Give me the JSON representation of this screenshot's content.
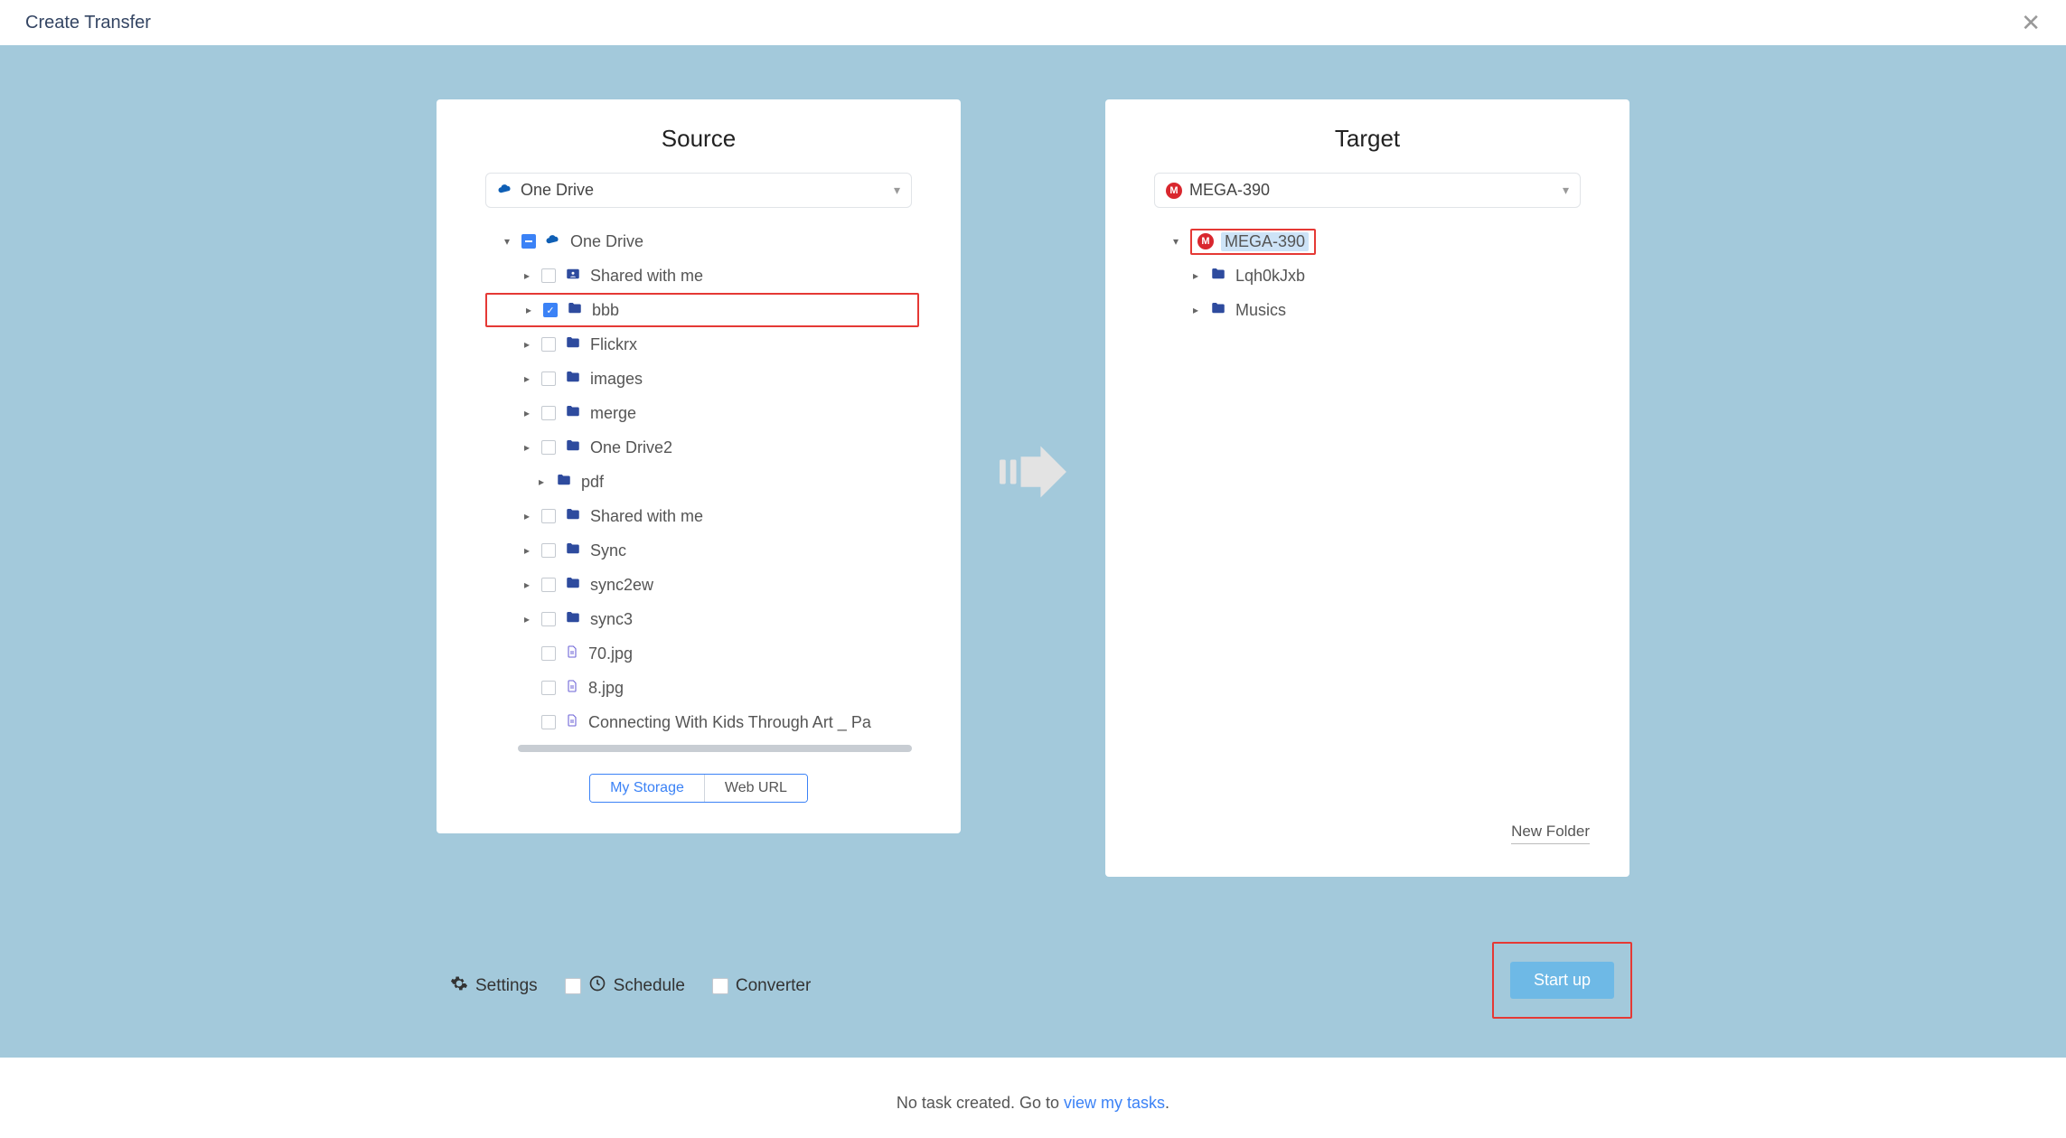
{
  "header": {
    "title": "Create Transfer",
    "close_glyph": "✕"
  },
  "source": {
    "title": "Source",
    "selected_service": "One Drive",
    "root": {
      "label": "One Drive"
    },
    "children": [
      {
        "type": "shared",
        "label": "Shared with me"
      },
      {
        "type": "folder",
        "label": "bbb",
        "checked": true,
        "highlight": true
      },
      {
        "type": "folder",
        "label": "Flickrx"
      },
      {
        "type": "folder",
        "label": "images"
      },
      {
        "type": "folder",
        "label": "merge"
      },
      {
        "type": "folder",
        "label": "One Drive2"
      },
      {
        "type": "folder",
        "label": "pdf",
        "depth2": true
      },
      {
        "type": "folder",
        "label": "Shared with me"
      },
      {
        "type": "folder",
        "label": "Sync"
      },
      {
        "type": "folder",
        "label": "sync2ew"
      },
      {
        "type": "folder",
        "label": "sync3"
      },
      {
        "type": "file",
        "label": "70.jpg"
      },
      {
        "type": "file",
        "label": "8.jpg"
      },
      {
        "type": "file",
        "label": "Connecting With Kids Through Art _ Pa"
      }
    ],
    "tabs": {
      "my_storage": "My Storage",
      "web_url": "Web URL"
    }
  },
  "target": {
    "title": "Target",
    "selected_service": "MEGA-390",
    "root": {
      "label": "MEGA-390"
    },
    "children": [
      {
        "type": "folder",
        "label": "Lqh0kJxb"
      },
      {
        "type": "folder",
        "label": "Musics"
      }
    ],
    "new_folder": "New Folder"
  },
  "options": {
    "settings": "Settings",
    "schedule": "Schedule",
    "converter": "Converter"
  },
  "start_button": "Start up",
  "footer": {
    "text_prefix": "No task created. Go to ",
    "link": "view my tasks",
    "text_suffix": "."
  }
}
